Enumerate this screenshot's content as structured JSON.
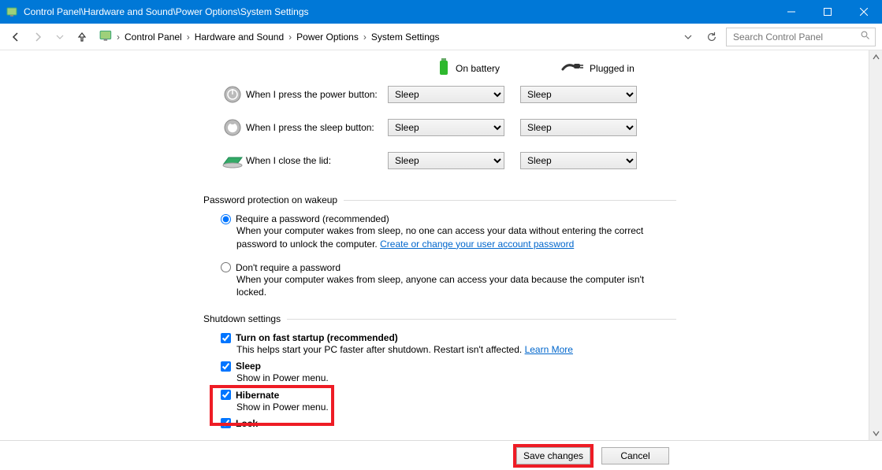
{
  "titlebar": {
    "text": "Control Panel\\Hardware and Sound\\Power Options\\System Settings"
  },
  "breadcrumb": {
    "items": [
      "Control Panel",
      "Hardware and Sound",
      "Power Options",
      "System Settings"
    ]
  },
  "search": {
    "placeholder": "Search Control Panel"
  },
  "columns": {
    "battery": "On battery",
    "plugged": "Plugged in"
  },
  "rows": {
    "power": {
      "label": "When I press the power button:",
      "battery": "Sleep",
      "plugged": "Sleep"
    },
    "sleep": {
      "label": "When I press the sleep button:",
      "battery": "Sleep",
      "plugged": "Sleep"
    },
    "lid": {
      "label": "When I close the lid:",
      "battery": "Sleep",
      "plugged": "Sleep"
    }
  },
  "password_section": {
    "title": "Password protection on wakeup",
    "require": {
      "label": "Require a password (recommended)",
      "desc": "When your computer wakes from sleep, no one can access your data without entering the correct password to unlock the computer. ",
      "link": "Create or change your user account password"
    },
    "norequire": {
      "label": "Don't require a password",
      "desc": "When your computer wakes from sleep, anyone can access your data because the computer isn't locked."
    }
  },
  "shutdown_section": {
    "title": "Shutdown settings",
    "fast": {
      "label": "Turn on fast startup (recommended)",
      "desc": "This helps start your PC faster after shutdown. Restart isn't affected. ",
      "link": "Learn More"
    },
    "sleep": {
      "label": "Sleep",
      "desc": "Show in Power menu."
    },
    "hibernate": {
      "label": "Hibernate",
      "desc": "Show in Power menu."
    },
    "lock": {
      "label": "Lock"
    }
  },
  "footer": {
    "save": "Save changes",
    "cancel": "Cancel"
  }
}
